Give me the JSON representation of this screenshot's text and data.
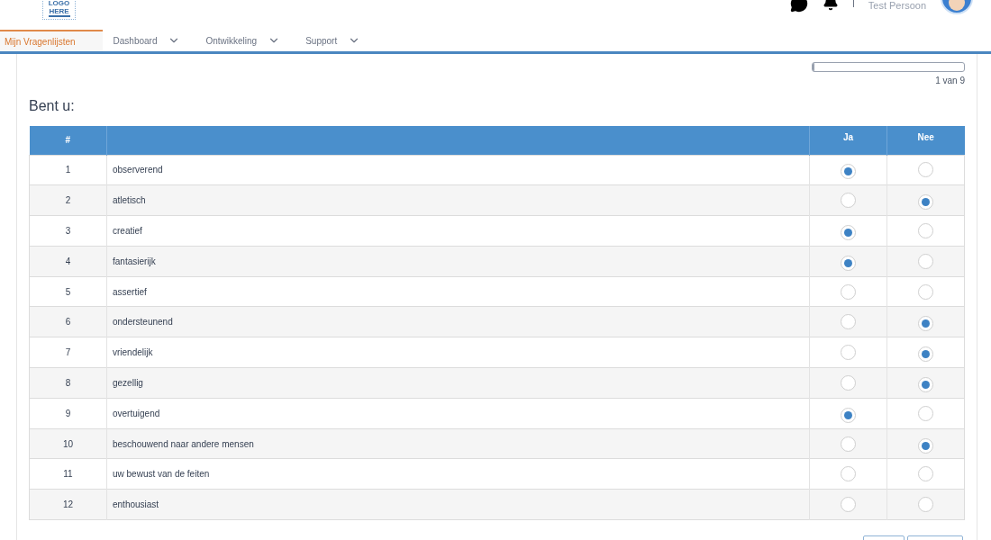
{
  "header": {
    "logo": "LOGO HERE",
    "user_name": "Test Persoon"
  },
  "nav": [
    {
      "label": "Mijn Vragenlijsten",
      "selected": true,
      "dropdown": false
    },
    {
      "label": "Dashboard",
      "selected": false,
      "dropdown": true
    },
    {
      "label": "Ontwikkeling",
      "selected": false,
      "dropdown": true
    },
    {
      "label": "Support",
      "selected": false,
      "dropdown": true
    }
  ],
  "progress": {
    "level": 0.01,
    "reading": "1 van 9"
  },
  "question": "Bent u:",
  "table": {
    "columns": [
      "#",
      "",
      "Ja",
      "Nee"
    ],
    "rows": [
      {
        "number": "1",
        "label": "observerend",
        "ja": true,
        "nee": false
      },
      {
        "number": "2",
        "label": "atletisch",
        "ja": false,
        "nee": true
      },
      {
        "number": "3",
        "label": "creatief",
        "ja": true,
        "nee": false
      },
      {
        "number": "4",
        "label": "fantasierijk",
        "ja": true,
        "nee": false
      },
      {
        "number": "5",
        "label": "assertief",
        "ja": false,
        "nee": false
      },
      {
        "number": "6",
        "label": "ondersteunend",
        "ja": false,
        "nee": true
      },
      {
        "number": "7",
        "label": "vriendelijk",
        "ja": false,
        "nee": true
      },
      {
        "number": "8",
        "label": "gezellig",
        "ja": false,
        "nee": true
      },
      {
        "number": "9",
        "label": "overtuigend",
        "ja": true,
        "nee": false
      },
      {
        "number": "10",
        "label": "beschouwend naar andere mensen",
        "ja": false,
        "nee": true
      },
      {
        "number": "11",
        "label": "uw bewust van de feiten",
        "ja": false,
        "nee": false
      },
      {
        "number": "12",
        "label": "enthousiast",
        "ja": false,
        "nee": false
      }
    ]
  }
}
